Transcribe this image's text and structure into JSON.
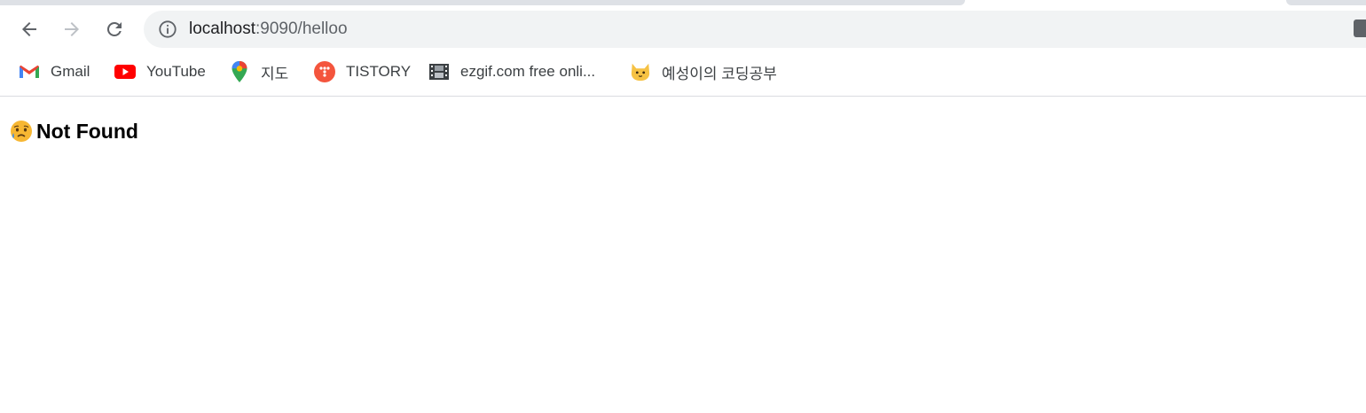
{
  "browser": {
    "url_host": "localhost",
    "url_rest": ":9090/helloo",
    "bookmarks": [
      {
        "label": "Gmail",
        "icon": "gmail-icon"
      },
      {
        "label": "YouTube",
        "icon": "youtube-icon"
      },
      {
        "label": "지도",
        "icon": "maps-pin-icon"
      },
      {
        "label": "TISTORY",
        "icon": "tistory-icon"
      },
      {
        "label": "ezgif.com free onli...",
        "icon": "film-icon"
      },
      {
        "label": "예성이의 코딩공부",
        "icon": "cat-icon"
      }
    ]
  },
  "page": {
    "heading": "Not Found",
    "heading_icon": "sad-face-emoji-icon"
  },
  "colors": {
    "toolbar_bg": "#ffffff",
    "omnibox_bg": "#f1f3f4",
    "youtube_red": "#ff0000",
    "tistory_orange": "#f4553d"
  }
}
